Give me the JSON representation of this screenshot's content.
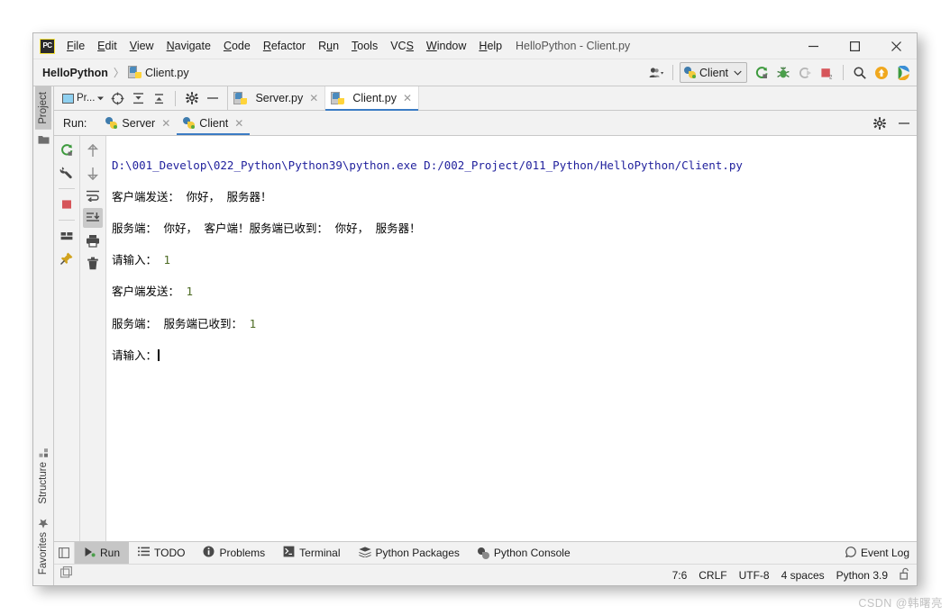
{
  "window": {
    "title": "HelloPython - Client.py",
    "logo_text": "PC",
    "minimize_label": "—",
    "maximize_label": "❐",
    "close_label": "✕"
  },
  "menu": {
    "items": [
      {
        "mnemonic": "F",
        "rest": "ile"
      },
      {
        "mnemonic": "E",
        "rest": "dit"
      },
      {
        "mnemonic": "V",
        "rest": "iew"
      },
      {
        "mnemonic": "N",
        "rest": "avigate"
      },
      {
        "mnemonic": "C",
        "rest": "ode"
      },
      {
        "mnemonic": "R",
        "rest": "efactor"
      },
      {
        "mnemonic": "R",
        "rest": "un",
        "pre": "R",
        "underline_index": 1
      },
      {
        "mnemonic": "T",
        "rest": "ools"
      },
      {
        "mnemonic": "S",
        "rest": "VCS",
        "full": "VCS"
      },
      {
        "mnemonic": "W",
        "rest": "indow"
      },
      {
        "mnemonic": "H",
        "rest": "elp"
      }
    ],
    "labels": [
      "File",
      "Edit",
      "View",
      "Navigate",
      "Code",
      "Refactor",
      "Run",
      "Tools",
      "VCS",
      "Window",
      "Help"
    ]
  },
  "navbar": {
    "project": "HelloPython",
    "separator": "〉",
    "file": "Client.py",
    "run_config": "Client",
    "run_config_caret": "⌄"
  },
  "editor": {
    "project_tool_label": "Pr...",
    "tabs": [
      {
        "label": "Server.py",
        "active": false,
        "close": "✕"
      },
      {
        "label": "Client.py",
        "active": true,
        "close": "✕"
      }
    ]
  },
  "left_stripe": {
    "top_tabs": [
      {
        "label": "Project",
        "active": true
      }
    ],
    "bottom_tabs": [
      {
        "label": "Structure",
        "active": false
      },
      {
        "label": "Favorites",
        "active": false
      }
    ]
  },
  "run_window": {
    "title": "Run:",
    "tabs": [
      {
        "label": "Server",
        "active": false,
        "close": "✕"
      },
      {
        "label": "Client",
        "active": true,
        "close": "✕"
      }
    ],
    "settings_icon": "gear-icon",
    "hide_icon": "—"
  },
  "console": {
    "command_line": "D:\\001_Develop\\022_Python\\Python39\\python.exe D:/002_Project/011_Python/HelloPython/Client.py",
    "lines": [
      {
        "text": "客户端发送： 你好， 服务器！",
        "input": ""
      },
      {
        "text": "服务端： 你好， 客户端！服务端已收到： 你好， 服务器！",
        "input": ""
      },
      {
        "text": "请输入： ",
        "input": "1"
      },
      {
        "text": "客户端发送： ",
        "input": "1"
      },
      {
        "text": "服务端： 服务端已收到： ",
        "input": "1"
      },
      {
        "text": "请输入：",
        "input": "",
        "caret": true
      }
    ]
  },
  "bottom_tools": [
    {
      "label": "Run",
      "icon": "run-icon",
      "active": true
    },
    {
      "label": "TODO",
      "icon": "todo-icon",
      "active": false
    },
    {
      "label": "Problems",
      "icon": "problems-icon",
      "active": false
    },
    {
      "label": "Terminal",
      "icon": "terminal-icon",
      "active": false
    },
    {
      "label": "Python Packages",
      "icon": "packages-icon",
      "active": false
    },
    {
      "label": "Python Console",
      "icon": "python-console-icon",
      "active": false
    }
  ],
  "event_log": {
    "label": "Event Log",
    "icon": "balloon-icon"
  },
  "status_bar": {
    "caret_position": "7:6",
    "line_separator": "CRLF",
    "encoding": "UTF-8",
    "indent": "4 spaces",
    "interpreter": "Python 3.9",
    "lock_icon": "unlocked-icon"
  },
  "watermark": "CSDN @韩曙亮",
  "colors": {
    "accent_blue": "#3b7cc4",
    "console_command": "#1f1f9c",
    "console_input": "#4d6b23",
    "chrome": "#f2f2f2",
    "python_blue": "#3f7cad",
    "python_yellow": "#f3cb3d",
    "stop_red": "#d6555a",
    "rerun_green": "#3d9a3d"
  }
}
